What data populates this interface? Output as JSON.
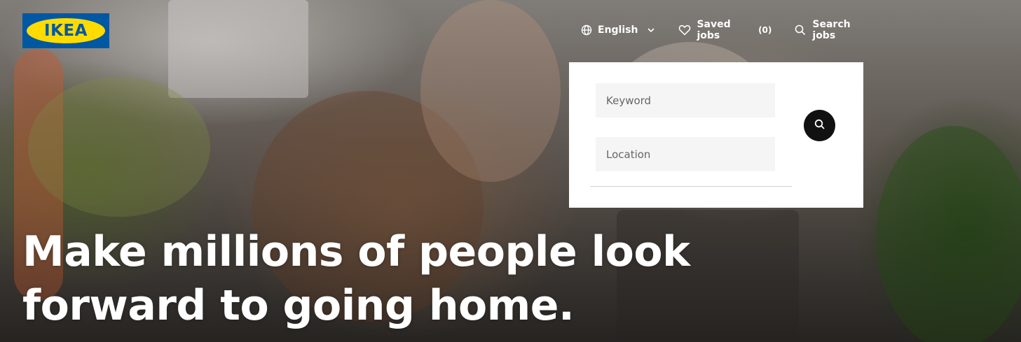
{
  "brand": {
    "logo_text": "IKEA",
    "colors": {
      "blue": "#0058a3",
      "yellow": "#ffdb00"
    }
  },
  "nav": {
    "language": {
      "icon": "globe-icon",
      "label": "English",
      "chevron": "chevron-down-icon"
    },
    "saved_jobs": {
      "icon": "heart-icon",
      "label": "Saved jobs",
      "count": "(0)"
    },
    "search_jobs": {
      "icon": "search-icon",
      "label": "Search jobs"
    }
  },
  "search": {
    "keyword_placeholder": "Keyword",
    "location_placeholder": "Location",
    "submit_icon": "search-icon"
  },
  "hero": {
    "headline_line1": "Make millions of people look",
    "headline_line2": "forward to going home."
  }
}
